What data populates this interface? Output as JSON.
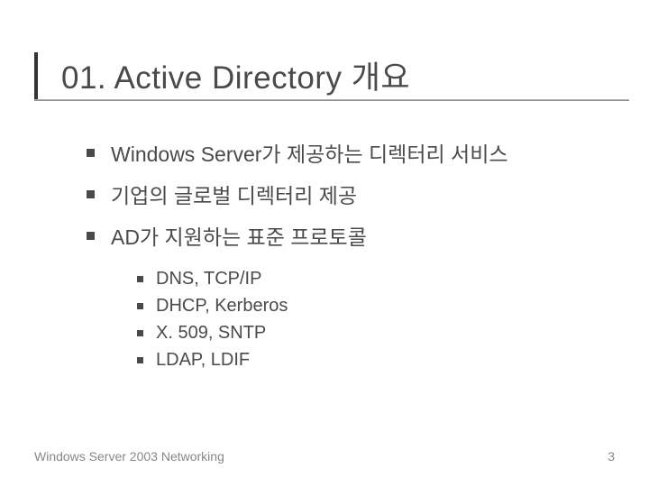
{
  "title": "01. Active Directory 개요",
  "bullets": [
    "Windows Server가 제공하는 디렉터리 서비스",
    "기업의 글로벌 디렉터리 제공",
    "AD가 지원하는 표준 프로토콜"
  ],
  "sub_bullets": [
    "DNS, TCP/IP",
    "DHCP, Kerberos",
    "X. 509, SNTP",
    "LDAP, LDIF"
  ],
  "footer": {
    "text": "Windows Server 2003 Networking",
    "page": "3"
  }
}
